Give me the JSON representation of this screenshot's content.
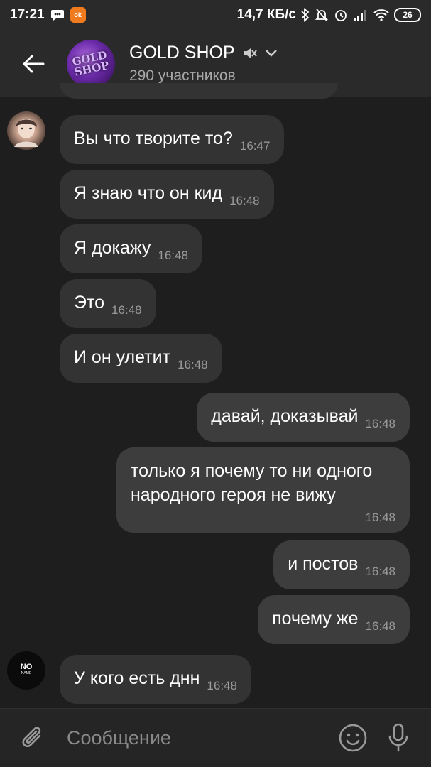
{
  "status_bar": {
    "time": "17:21",
    "ok_badge": "ok",
    "net_speed": "14,7 КБ/с",
    "battery": "26"
  },
  "header": {
    "title": "GOLD SHOP",
    "subtitle": "290 участников",
    "avatar_text_1": "GOLD",
    "avatar_text_2": "SHOP"
  },
  "messages": [
    {
      "text": "Вы что творите то?",
      "time": "16:47",
      "dir": "in"
    },
    {
      "text": "Я знаю что он кид",
      "time": "16:48",
      "dir": "in"
    },
    {
      "text": "Я докажу",
      "time": "16:48",
      "dir": "in"
    },
    {
      "text": "Это",
      "time": "16:48",
      "dir": "in"
    },
    {
      "text": "И он улетит",
      "time": "16:48",
      "dir": "in"
    },
    {
      "text": "давай, доказывай",
      "time": "16:48",
      "dir": "out"
    },
    {
      "text_line1": "только я почему то ни одного",
      "text_line2": "народного героя не вижу",
      "time": "16:48",
      "dir": "out"
    },
    {
      "text": "и постов",
      "time": "16:48",
      "dir": "out"
    },
    {
      "text": "почему же",
      "time": "16:48",
      "dir": "out"
    },
    {
      "text": "У кого есть днн",
      "time": "16:48",
      "dir": "in"
    }
  ],
  "noname_avatar": {
    "line1": "NO",
    "line2": "NAME"
  },
  "input": {
    "placeholder": "Сообщение"
  },
  "colors": {
    "background": "#1e1e1e",
    "bar": "#2a2a2a",
    "bubble": "#333333",
    "bubble_out": "#3d3d3d",
    "timestamp": "#9a9a9a"
  }
}
